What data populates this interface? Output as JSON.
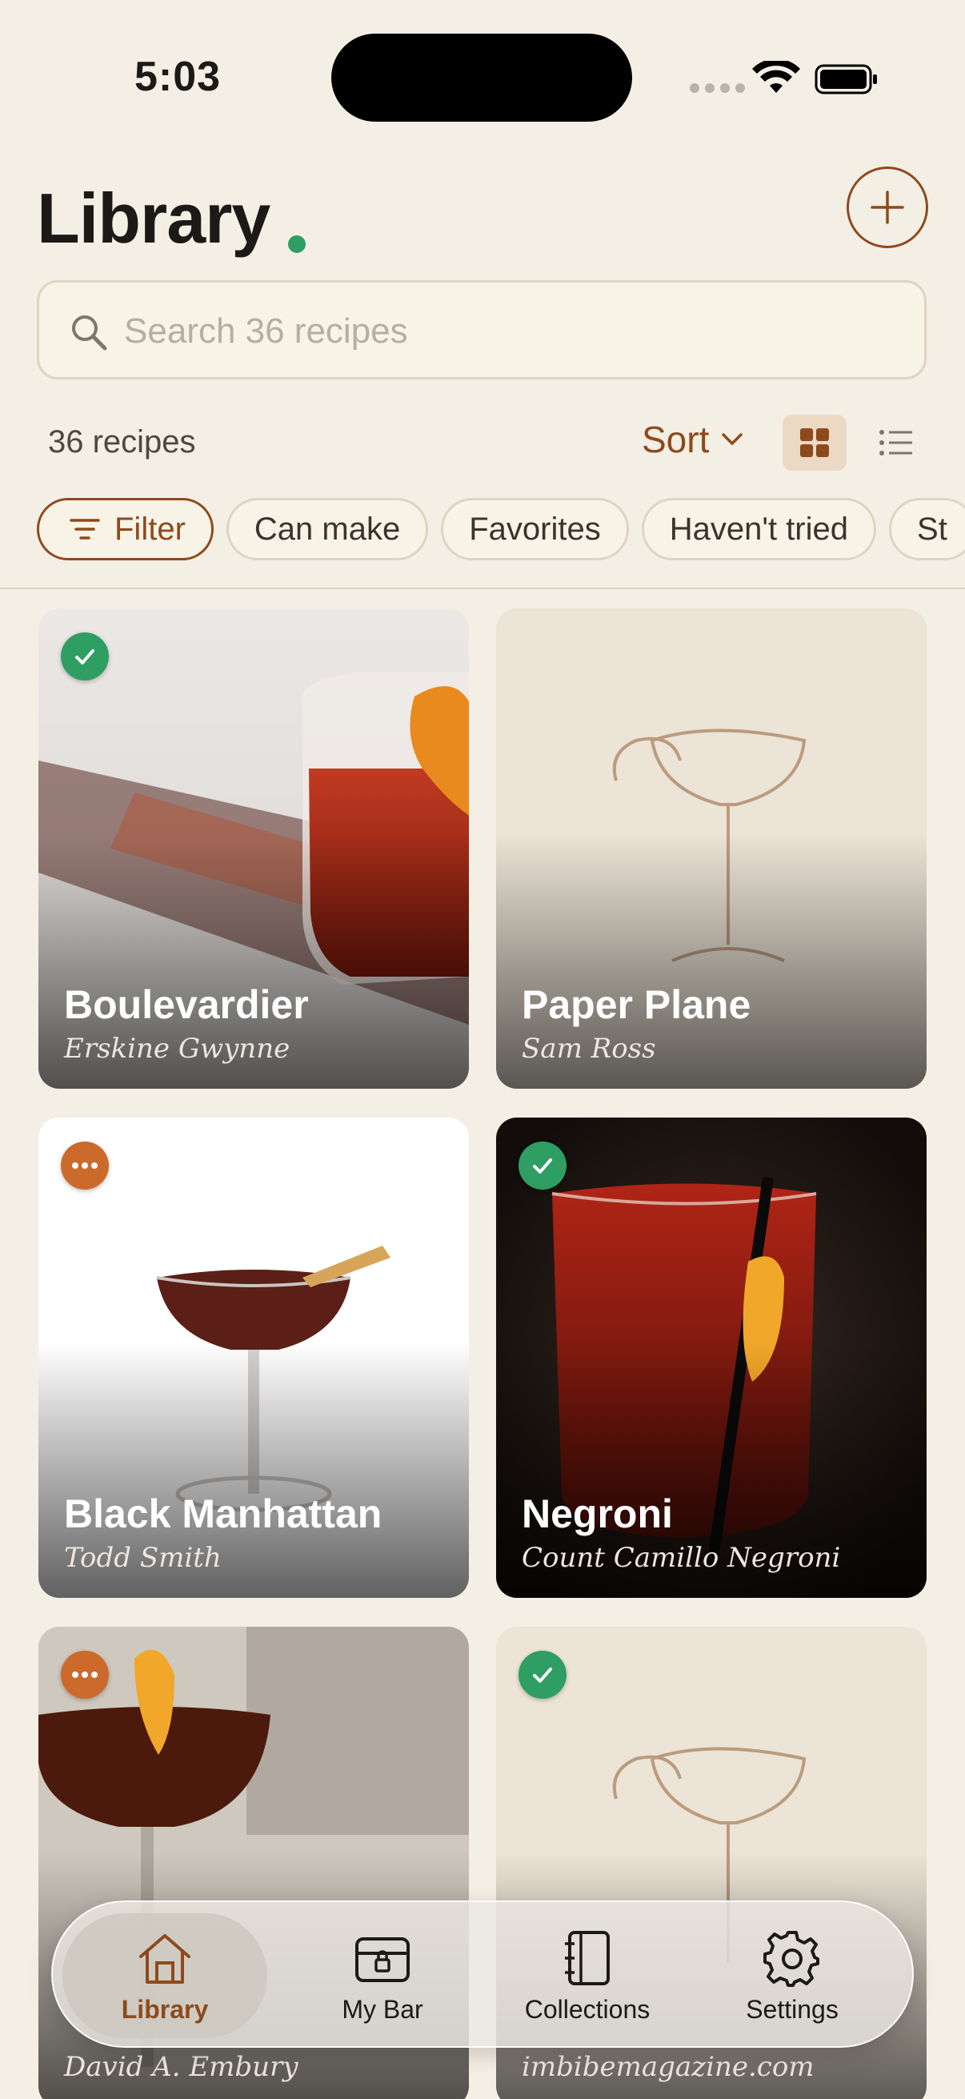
{
  "status_bar": {
    "time": "5:03"
  },
  "header": {
    "title": "Library"
  },
  "search": {
    "placeholder": "Search 36 recipes"
  },
  "toolbar": {
    "count_label": "36 recipes",
    "sort_label": "Sort",
    "view_mode": "grid"
  },
  "chips": [
    {
      "label": "Filter"
    },
    {
      "label": "Can make"
    },
    {
      "label": "Favorites"
    },
    {
      "label": "Haven't tried"
    },
    {
      "label": "St"
    }
  ],
  "recipes": [
    {
      "name": "Boulevardier",
      "author": "Erskine Gwynne",
      "badge": "check"
    },
    {
      "name": "Paper Plane",
      "author": "Sam Ross",
      "badge": "none"
    },
    {
      "name": "Black Manhattan",
      "author": "Todd Smith",
      "badge": "more"
    },
    {
      "name": "Negroni",
      "author": "Count Camillo Negroni",
      "badge": "check"
    },
    {
      "name": "",
      "author": "David A. Embury",
      "badge": "more"
    },
    {
      "name": "",
      "author": "imbibemagazine.com",
      "badge": "check"
    }
  ],
  "tabbar": {
    "active": "Library",
    "items": [
      {
        "label": "Library",
        "icon": "house-icon"
      },
      {
        "label": "My Bar",
        "icon": "cabinet-lock-icon"
      },
      {
        "label": "Collections",
        "icon": "notebook-icon"
      },
      {
        "label": "Settings",
        "icon": "gear-icon"
      }
    ]
  },
  "colors": {
    "accent": "#8e4a1c",
    "background": "#f4efe5",
    "check": "#2f9e63",
    "more": "#cc6a2b"
  }
}
